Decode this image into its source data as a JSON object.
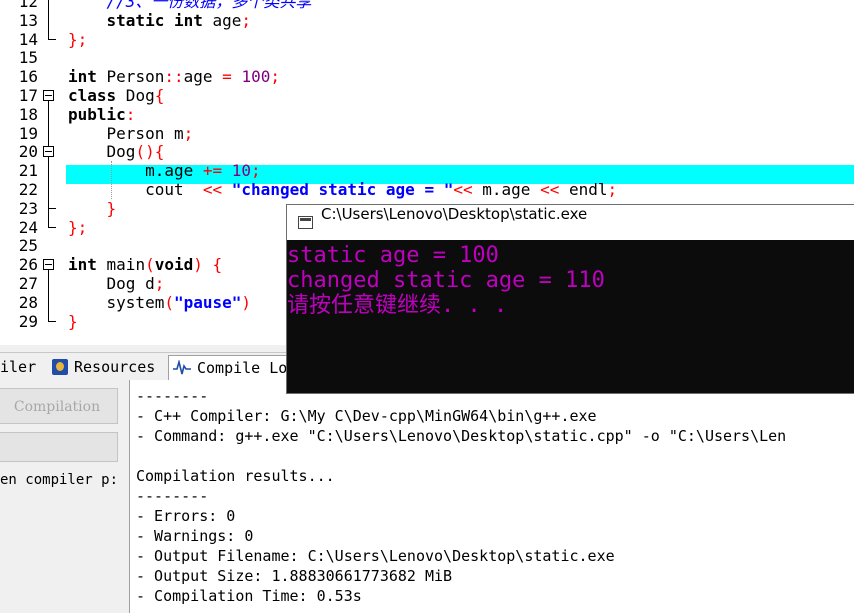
{
  "editor": {
    "lines": [
      {
        "num": "12",
        "code": "    //3、一份数据，多个类共享"
      },
      {
        "num": "13",
        "code": "    static int age;"
      },
      {
        "num": "14",
        "code": "};"
      },
      {
        "num": "15",
        "code": ""
      },
      {
        "num": "16",
        "code": "int Person::age = 100;"
      },
      {
        "num": "17",
        "code": "class Dog{"
      },
      {
        "num": "18",
        "code": "public:"
      },
      {
        "num": "19",
        "code": "    Person m;"
      },
      {
        "num": "20",
        "code": "    Dog(){"
      },
      {
        "num": "21",
        "code": "        m.age += 10;"
      },
      {
        "num": "22",
        "code": "        cout  << \"changed static age = \"<< m.age << endl;"
      },
      {
        "num": "23",
        "code": "    }"
      },
      {
        "num": "24",
        "code": "};"
      },
      {
        "num": "25",
        "code": ""
      },
      {
        "num": "26",
        "code": "int main(void) {"
      },
      {
        "num": "27",
        "code": "    Dog d;"
      },
      {
        "num": "28",
        "code": "    system(\"pause\")"
      },
      {
        "num": "29",
        "code": "}"
      }
    ],
    "highlight_color": "#00ffff"
  },
  "tabs": {
    "compiler": "iler",
    "resources": "Resources",
    "compile_log": "Compile Lo"
  },
  "leftpanel": {
    "compile_button": "Compilation",
    "options_label": "en compiler p:"
  },
  "log": {
    "lines": [
      "--------",
      "- C++ Compiler: G:\\My C\\Dev-cpp\\MinGW64\\bin\\g++.exe",
      "- Command: g++.exe \"C:\\Users\\Lenovo\\Desktop\\static.cpp\" -o \"C:\\Users\\Len",
      "",
      "Compilation results...",
      "--------",
      "- Errors: 0",
      "- Warnings: 0",
      "- Output Filename: C:\\Users\\Lenovo\\Desktop\\static.exe",
      "- Output Size: 1.88830661773682 MiB",
      "- Compilation Time: 0.53s"
    ]
  },
  "console": {
    "title": "C:\\Users\\Lenovo\\Desktop\\static.exe",
    "output": [
      "static age = 100",
      "changed static age = 110",
      "请按任意键继续. . ."
    ],
    "text_color": "#c000c0",
    "bg_color": "#0c0c0c"
  },
  "icons": {
    "fold": "fold-minus-icon",
    "resources": "resources-icon",
    "compile_log": "compile-log-icon",
    "console": "console-window-icon"
  }
}
